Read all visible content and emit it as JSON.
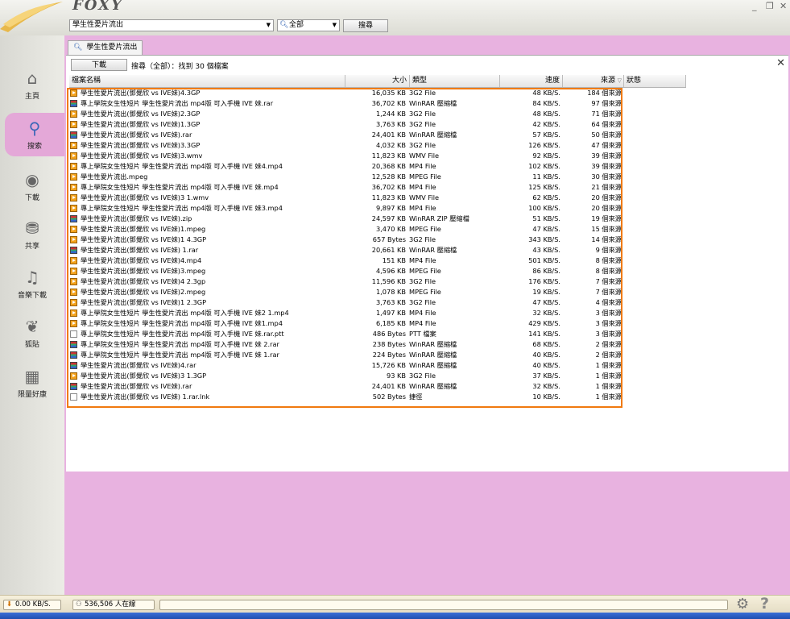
{
  "app": {
    "brand": "FOXY"
  },
  "search": {
    "query": "學生性愛片流出",
    "scope": "全部",
    "button": "搜尋"
  },
  "tab": {
    "label": "學生性愛片流出"
  },
  "toolbar": {
    "download": "下載",
    "status": "搜尋（全部）：找到 30 個檔案"
  },
  "sidebar": {
    "items": [
      {
        "label": "主頁",
        "icon": "home-icon"
      },
      {
        "label": "搜索",
        "icon": "search-icon"
      },
      {
        "label": "下載",
        "icon": "download-icon"
      },
      {
        "label": "共享",
        "icon": "share-icon"
      },
      {
        "label": "音樂下載",
        "icon": "music-icon"
      },
      {
        "label": "狐貼",
        "icon": "sticker-icon"
      },
      {
        "label": "限量好康",
        "icon": "gift-icon"
      }
    ]
  },
  "table": {
    "headers": {
      "name": "檔案名稱",
      "size": "大小",
      "type": "類型",
      "speed": "速度",
      "sources": "來源",
      "status": "狀態"
    },
    "rows": [
      {
        "icon": "media",
        "name": "學生性愛片流出(鄧覺欣 vs IVE妹)4.3GP",
        "size": "16,035 KB",
        "type": "3G2 File",
        "speed": "48 KB/S.",
        "sources": "184 個來源"
      },
      {
        "icon": "rar",
        "name": "專上學院女生性短片 學生性愛片流出 mp4版 可入手機 IVE 妹.rar",
        "size": "36,702 KB",
        "type": "WinRAR 壓縮檔",
        "speed": "84 KB/S.",
        "sources": "97 個來源"
      },
      {
        "icon": "media",
        "name": "學生性愛片流出(鄧覺欣 vs IVE妹)2.3GP",
        "size": "1,244 KB",
        "type": "3G2 File",
        "speed": "48 KB/S.",
        "sources": "71 個來源"
      },
      {
        "icon": "media",
        "name": "學生性愛片流出(鄧覺欣 vs IVE妹)1.3GP",
        "size": "3,763 KB",
        "type": "3G2 File",
        "speed": "42 KB/S.",
        "sources": "64 個來源"
      },
      {
        "icon": "rar",
        "name": "學生性愛片流出(鄧覺欣 vs IVE妹).rar",
        "size": "24,401 KB",
        "type": "WinRAR 壓縮檔",
        "speed": "57 KB/S.",
        "sources": "50 個來源"
      },
      {
        "icon": "media",
        "name": "學生性愛片流出(鄧覺欣 vs IVE妹)3.3GP",
        "size": "4,032 KB",
        "type": "3G2 File",
        "speed": "126 KB/S.",
        "sources": "47 個來源"
      },
      {
        "icon": "media",
        "name": "學生性愛片流出(鄧覺欣 vs IVE妹)3.wmv",
        "size": "11,823 KB",
        "type": "WMV File",
        "speed": "92 KB/S.",
        "sources": "39 個來源"
      },
      {
        "icon": "media",
        "name": "專上學院女生性短片 學生性愛片流出 mp4版 可入手機 IVE 妹4.mp4",
        "size": "20,368 KB",
        "type": "MP4 File",
        "speed": "102 KB/S.",
        "sources": "39 個來源"
      },
      {
        "icon": "media",
        "name": "學生性愛片流出.mpeg",
        "size": "12,528 KB",
        "type": "MPEG File",
        "speed": "11 KB/S.",
        "sources": "30 個來源"
      },
      {
        "icon": "media",
        "name": "專上學院女生性短片 學生性愛片流出 mp4版 可入手機 IVE 妹.mp4",
        "size": "36,702 KB",
        "type": "MP4 File",
        "speed": "125 KB/S.",
        "sources": "21 個來源"
      },
      {
        "icon": "media",
        "name": "學生性愛片流出(鄧覺欣 vs IVE妹)3 1.wmv",
        "size": "11,823 KB",
        "type": "WMV File",
        "speed": "62 KB/S.",
        "sources": "20 個來源"
      },
      {
        "icon": "media",
        "name": "專上學院女生性短片 學生性愛片流出 mp4版 可入手機 IVE 妹3.mp4",
        "size": "9,897 KB",
        "type": "MP4 File",
        "speed": "100 KB/S.",
        "sources": "20 個來源"
      },
      {
        "icon": "rar",
        "name": "學生性愛片流出(鄧覺欣 vs IVE妹).zip",
        "size": "24,597 KB",
        "type": "WinRAR ZIP 壓縮檔",
        "speed": "51 KB/S.",
        "sources": "19 個來源"
      },
      {
        "icon": "media",
        "name": "學生性愛片流出(鄧覺欣 vs IVE妹)1.mpeg",
        "size": "3,470 KB",
        "type": "MPEG File",
        "speed": "47 KB/S.",
        "sources": "15 個來源"
      },
      {
        "icon": "media",
        "name": "學生性愛片流出(鄧覺欣 vs IVE妹)1 4.3GP",
        "size": "657 Bytes",
        "type": "3G2 File",
        "speed": "343 KB/S.",
        "sources": "14 個來源"
      },
      {
        "icon": "rar",
        "name": "學生性愛片流出(鄧覺欣 vs IVE妹) 1.rar",
        "size": "20,661 KB",
        "type": "WinRAR 壓縮檔",
        "speed": "43 KB/S.",
        "sources": "9 個來源"
      },
      {
        "icon": "media",
        "name": "學生性愛片流出(鄧覺欣 vs IVE妹)4.mp4",
        "size": "151 KB",
        "type": "MP4 File",
        "speed": "501 KB/S.",
        "sources": "8 個來源"
      },
      {
        "icon": "media",
        "name": "學生性愛片流出(鄧覺欣 vs IVE妹)3.mpeg",
        "size": "4,596 KB",
        "type": "MPEG File",
        "speed": "86 KB/S.",
        "sources": "8 個來源"
      },
      {
        "icon": "media",
        "name": "學生性愛片流出(鄧覺欣 vs IVE妹)4 2.3gp",
        "size": "11,596 KB",
        "type": "3G2 File",
        "speed": "176 KB/S.",
        "sources": "7 個來源"
      },
      {
        "icon": "media",
        "name": "學生性愛片流出(鄧覺欣 vs IVE妹)2.mpeg",
        "size": "1,078 KB",
        "type": "MPEG File",
        "speed": "19 KB/S.",
        "sources": "7 個來源"
      },
      {
        "icon": "media",
        "name": "學生性愛片流出(鄧覺欣 vs IVE妹)1 2.3GP",
        "size": "3,763 KB",
        "type": "3G2 File",
        "speed": "47 KB/S.",
        "sources": "4 個來源"
      },
      {
        "icon": "media",
        "name": "專上學院女生性短片 學生性愛片流出 mp4版 可入手機 IVE 妹2 1.mp4",
        "size": "1,497 KB",
        "type": "MP4 File",
        "speed": "32 KB/S.",
        "sources": "3 個來源"
      },
      {
        "icon": "media",
        "name": "專上學院女生性短片 學生性愛片流出 mp4版 可入手機 IVE 妹1.mp4",
        "size": "6,185 KB",
        "type": "MP4 File",
        "speed": "429 KB/S.",
        "sources": "3 個來源"
      },
      {
        "icon": "doc",
        "name": "專上學院女生性短片 學生性愛片流出 mp4版 可入手機 IVE 妹.rar.ptt",
        "size": "486 Bytes",
        "type": "PTT 檔案",
        "speed": "141 KB/S.",
        "sources": "3 個來源"
      },
      {
        "icon": "rar",
        "name": "專上學院女生性短片 學生性愛片流出 mp4版 可入手機 IVE 妹 2.rar",
        "size": "238 Bytes",
        "type": "WinRAR 壓縮檔",
        "speed": "68 KB/S.",
        "sources": "2 個來源"
      },
      {
        "icon": "rar",
        "name": "專上學院女生性短片 學生性愛片流出 mp4版 可入手機 IVE 妹 1.rar",
        "size": "224 Bytes",
        "type": "WinRAR 壓縮檔",
        "speed": "40 KB/S.",
        "sources": "2 個來源"
      },
      {
        "icon": "rar",
        "name": "學生性愛片流出(鄧覺欣 vs IVE妹)4.rar",
        "size": "15,726 KB",
        "type": "WinRAR 壓縮檔",
        "speed": "40 KB/S.",
        "sources": "1 個來源"
      },
      {
        "icon": "media",
        "name": "學生性愛片流出(鄧覺欣 vs IVE妹)3 1.3GP",
        "size": "93 KB",
        "type": "3G2 File",
        "speed": "37 KB/S.",
        "sources": "1 個來源"
      },
      {
        "icon": "rar",
        "name": "學生性愛片流出(鄧覺欣 vs IVE妹).rar",
        "size": "24,401 KB",
        "type": "WinRAR 壓縮檔",
        "speed": "32 KB/S.",
        "sources": "1 個來源"
      },
      {
        "icon": "doc",
        "name": "學生性愛片流出(鄧覺欣 vs IVE妹) 1.rar.lnk",
        "size": "502 Bytes",
        "type": "捷徑",
        "speed": "10 KB/S.",
        "sources": "1 個來源"
      }
    ]
  },
  "statusbar": {
    "speed": "0.00 KB/S.",
    "online": "536,506 人在線"
  },
  "colors": {
    "accent_pink": "#e8b2e0",
    "highlight_orange": "#f07a10"
  }
}
